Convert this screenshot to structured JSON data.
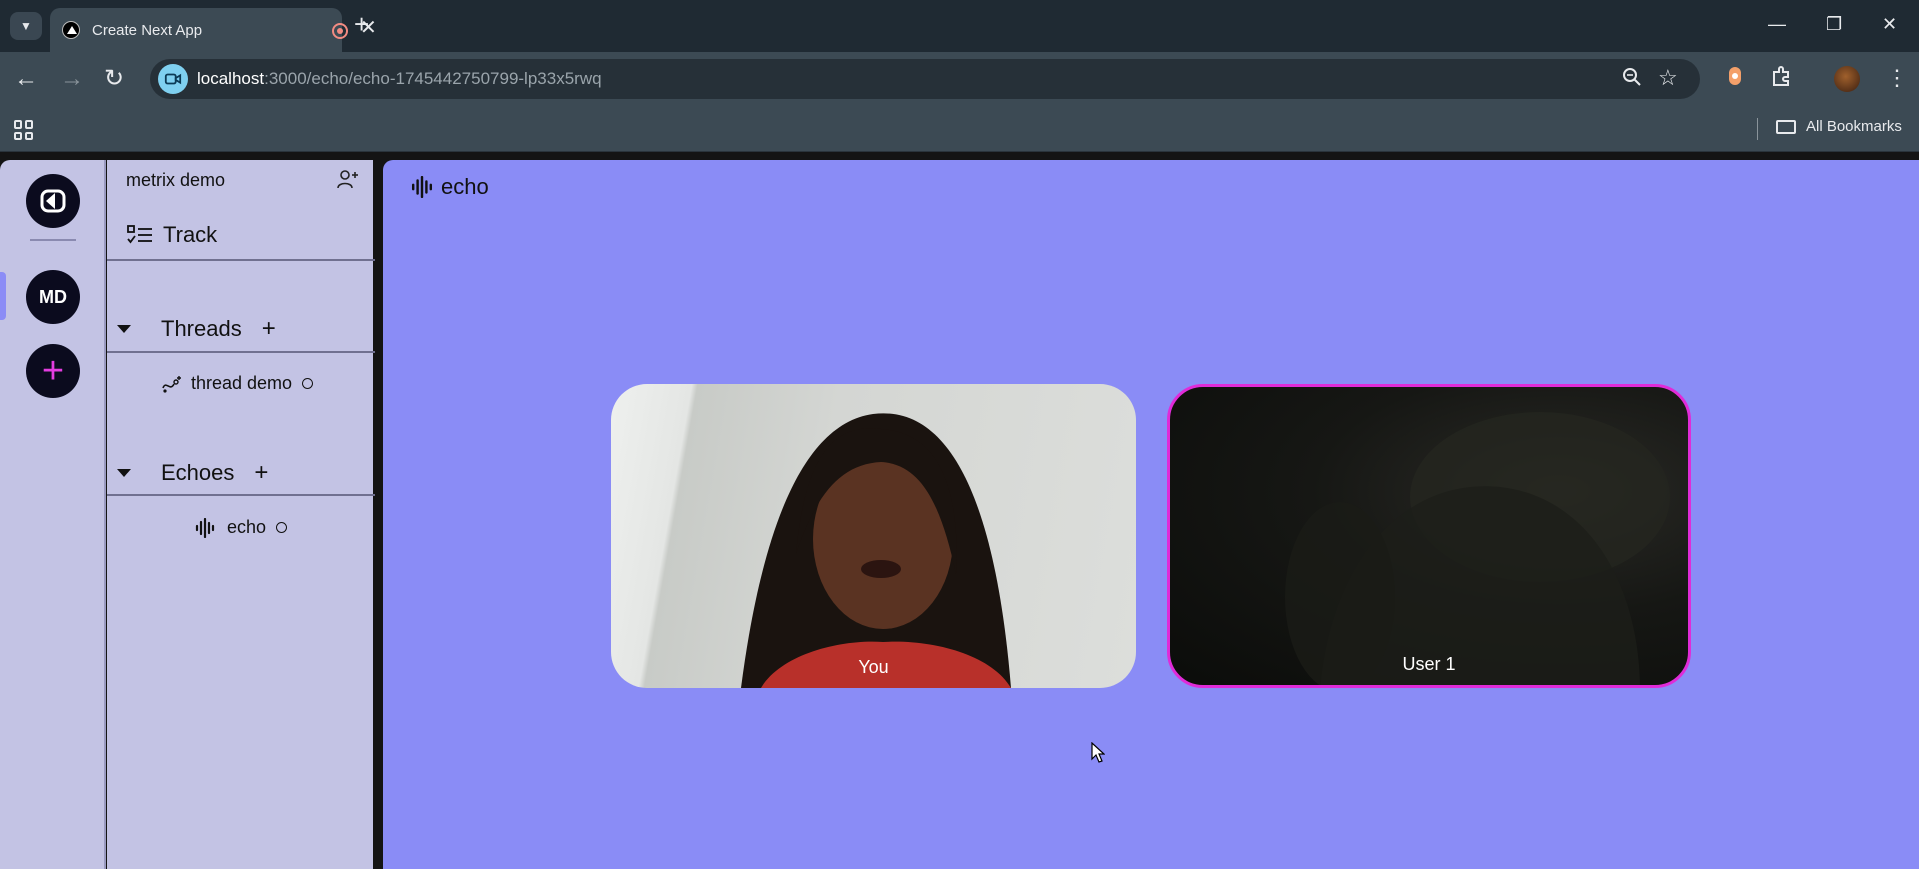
{
  "browser": {
    "tab_title": "Create Next App",
    "url_host": "localhost",
    "url_path": ":3000/echo/echo-1745442750799-lp33x5rwq",
    "bookmarks_label": "All Bookmarks"
  },
  "rail": {
    "workspace_initials": "MD",
    "add_symbol": "+"
  },
  "sidebar": {
    "workspace_name": "metrix demo",
    "track_label": "Track",
    "threads": {
      "title": "Threads",
      "add_symbol": "+",
      "items": [
        {
          "label": "thread demo"
        }
      ]
    },
    "echoes": {
      "title": "Echoes",
      "add_symbol": "+",
      "items": [
        {
          "label": "echo"
        }
      ]
    }
  },
  "main": {
    "header_title": "echo",
    "participants": [
      {
        "label": "You"
      },
      {
        "label": "User 1",
        "highlight_color": "#e02bd8"
      }
    ]
  },
  "colors": {
    "sidebar_bg": "#c3c3e4",
    "main_bg": "#8a8cf6",
    "accent_pink": "#e43de0"
  }
}
